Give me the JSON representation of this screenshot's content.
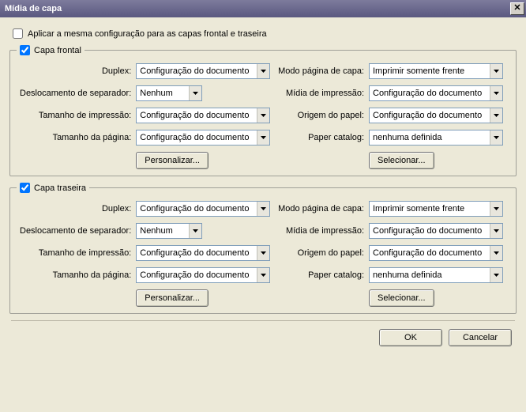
{
  "window": {
    "title": "Mídia de capa"
  },
  "apply_same": {
    "label": "Aplicar a mesma configuração para as capas frontal e traseira",
    "checked": false
  },
  "labels": {
    "duplex": "Duplex:",
    "separator_shift": "Deslocamento de separador:",
    "print_size": "Tamanho de impressão:",
    "page_size": "Tamanho da página:",
    "cover_page_mode": "Modo página de capa:",
    "print_media": "Mídia de impressão:",
    "paper_source": "Origem do papel:",
    "paper_catalog": "Paper catalog:",
    "customize": "Personalizar...",
    "select": "Selecionar..."
  },
  "front": {
    "legend": "Capa frontal",
    "checked": true,
    "duplex": "Configuração do documento",
    "separator_shift": "Nenhum",
    "print_size": "Configuração do documento",
    "page_size": "Configuração do documento",
    "cover_page_mode": "Imprimir somente frente",
    "print_media": "Configuração do documento",
    "paper_source": "Configuração do documento",
    "paper_catalog": "nenhuma definida"
  },
  "back": {
    "legend": "Capa traseira",
    "checked": true,
    "duplex": "Configuração do documento",
    "separator_shift": "Nenhum",
    "print_size": "Configuração do documento",
    "page_size": "Configuração do documento",
    "cover_page_mode": "Imprimir somente frente",
    "print_media": "Configuração do documento",
    "paper_source": "Configuração do documento",
    "paper_catalog": "nenhuma definida"
  },
  "footer": {
    "ok": "OK",
    "cancel": "Cancelar"
  }
}
